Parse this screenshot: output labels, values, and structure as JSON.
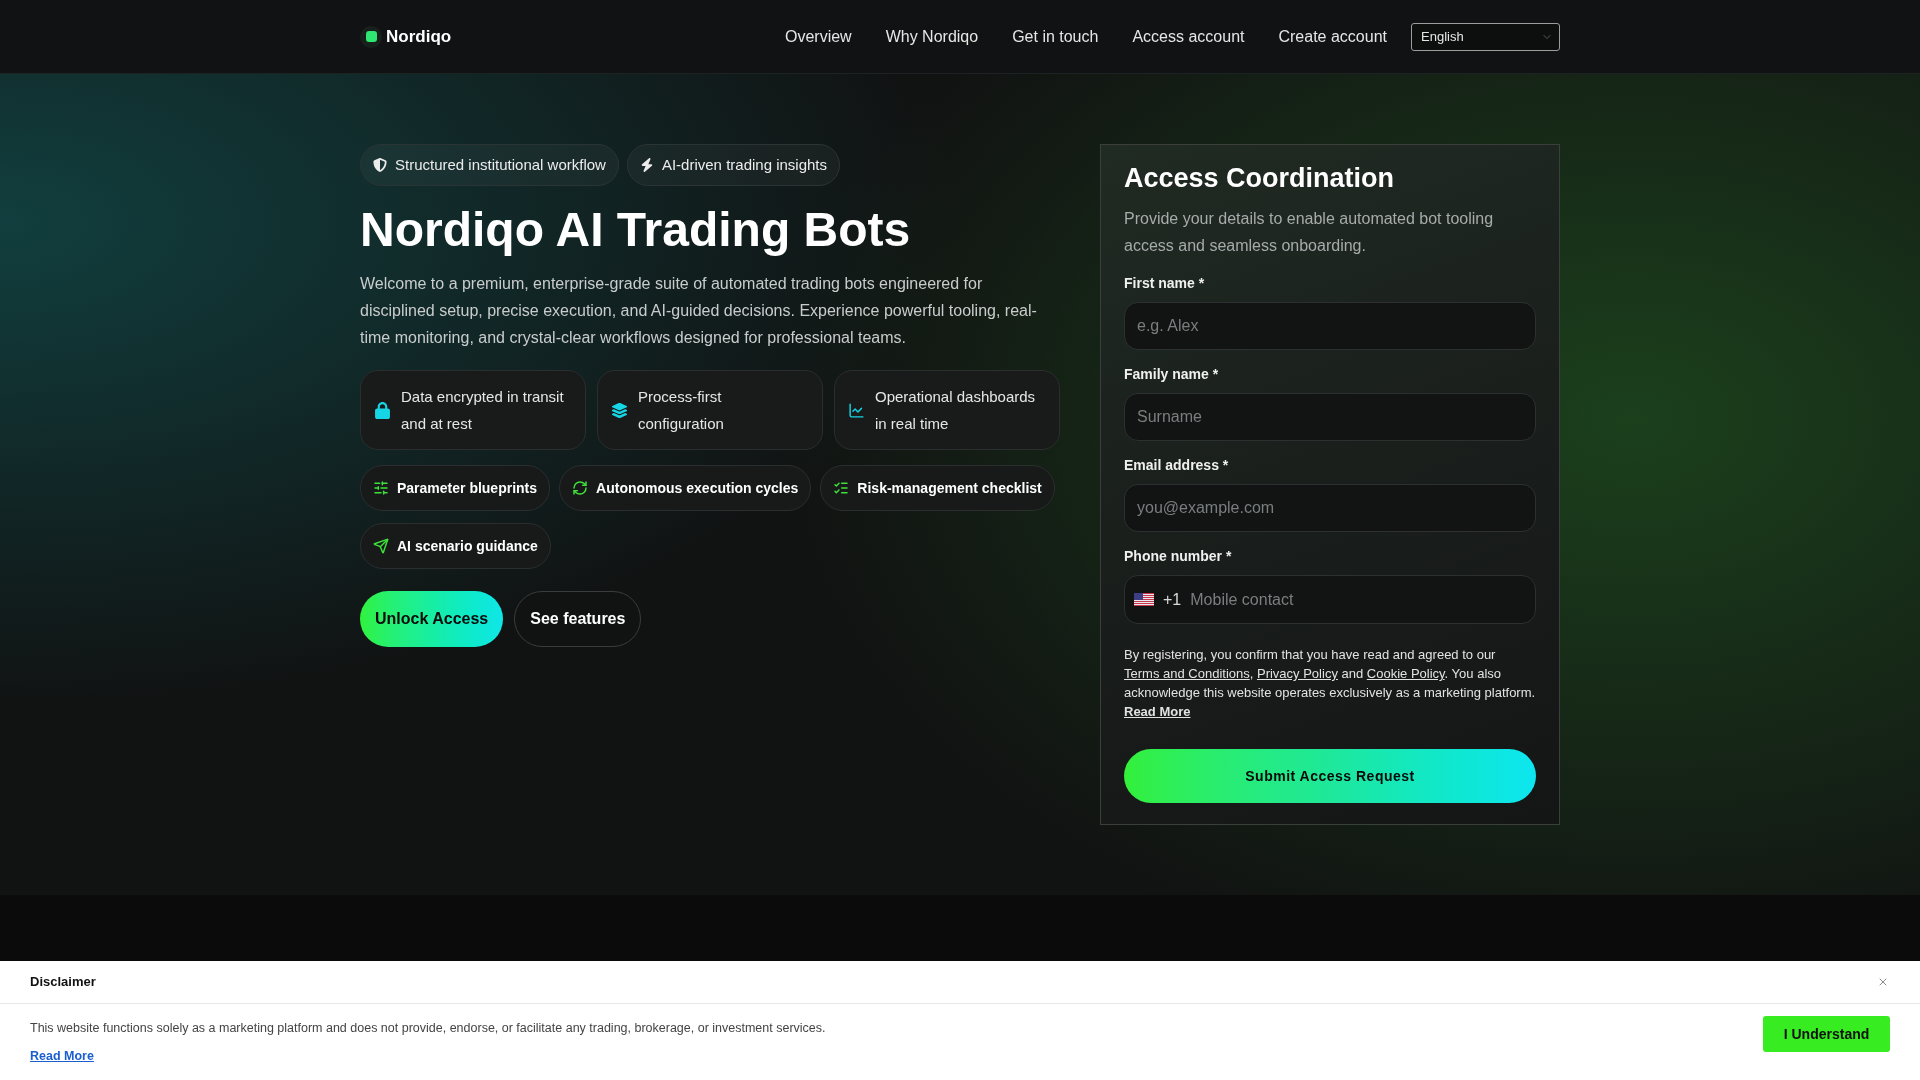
{
  "header": {
    "brand": "Nordiqo",
    "nav": [
      {
        "label": "Overview"
      },
      {
        "label": "Why Nordiqo"
      },
      {
        "label": "Get in touch"
      },
      {
        "label": "Access account"
      },
      {
        "label": "Create account"
      }
    ],
    "language": {
      "value": "English"
    }
  },
  "hero": {
    "badges": [
      "Structured institutional workflow",
      "AI-driven trading insights"
    ],
    "title": "Nordiqo AI Trading Bots",
    "intro": "Welcome to a premium, enterprise-grade suite of automated trading bots engineered for disciplined setup, precise execution, and AI-guided decisions. Experience powerful tooling, real-time monitoring, and crystal-clear workflows designed for professional teams.",
    "features": [
      "Data encrypted in transit and at rest",
      "Process-first configuration",
      "Operational dashboards in real time"
    ],
    "highlights": [
      "Parameter blueprints",
      "Autonomous execution cycles",
      "Risk-management checklist",
      "AI scenario guidance"
    ],
    "actions": [
      {
        "label": "Unlock Access",
        "kind": "primary"
      },
      {
        "label": "See features",
        "kind": "secondary"
      }
    ]
  },
  "form": {
    "title": "Access Coordination",
    "description": "Provide your details to enable automated bot tooling access and seamless onboarding.",
    "fields": [
      {
        "kind": "text",
        "label": "First name *",
        "placeholder": "e.g. Alex"
      },
      {
        "kind": "text",
        "label": "Family name *",
        "placeholder": "Surname"
      },
      {
        "kind": "email",
        "label": "Email address *",
        "placeholder": "you@example.com"
      },
      {
        "kind": "phone",
        "label": "Phone number *",
        "dial_code": "+1",
        "placeholder": "Mobile contact"
      }
    ],
    "consent": [
      {
        "kind": "text",
        "text": "By registering, you confirm that you have read and agreed to our "
      },
      {
        "kind": "link",
        "text": "Terms and Conditions"
      },
      {
        "kind": "text",
        "text": ", "
      },
      {
        "kind": "link",
        "text": "Privacy Policy"
      },
      {
        "kind": "text",
        "text": " and "
      },
      {
        "kind": "link",
        "text": "Cookie Policy"
      },
      {
        "kind": "text",
        "text": ". You also acknowledge this website operates exclusively as a marketing platform. "
      },
      {
        "kind": "strong_link",
        "text": "Read More"
      }
    ],
    "submit": "Submit Access Request"
  },
  "disclaimer": {
    "title": "Disclaimer",
    "text": "This website functions solely as a marketing platform and does not provide, endorse, or facilitate any trading, brokerage, or investment services.",
    "link": "Read More",
    "button": "I Understand"
  }
}
